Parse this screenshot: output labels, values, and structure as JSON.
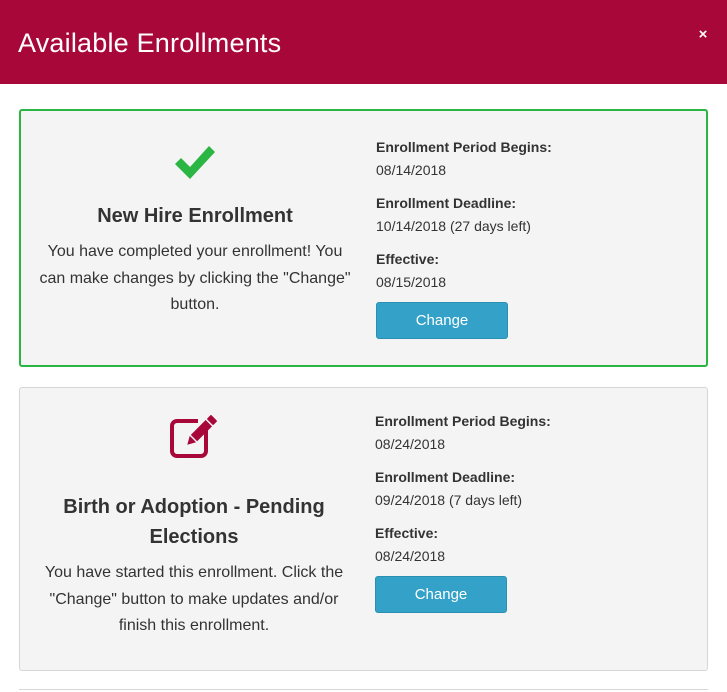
{
  "modal": {
    "title": "Available Enrollments",
    "close_label": "×"
  },
  "colors": {
    "header": "#a8073a",
    "success": "#2bb542",
    "pending_icon": "#a8073a",
    "button": "#34a2c8"
  },
  "enrollments": [
    {
      "icon": "checkmark-icon",
      "title": "New Hire Enrollment",
      "description": "You have completed your enrollment! You can make changes by clicking the \"Change\" button.",
      "period_begins_label": "Enrollment Period Begins:",
      "period_begins": "08/14/2018",
      "deadline_label": "Enrollment Deadline:",
      "deadline": "10/14/2018 (27 days left)",
      "effective_label": "Effective:",
      "effective": "08/15/2018",
      "button_label": "Change"
    },
    {
      "icon": "edit-icon",
      "title": "Birth or Adoption - Pending Elections",
      "description": "You have started this enrollment. Click the \"Change\" button to make updates and/or finish this enrollment.",
      "period_begins_label": "Enrollment Period Begins:",
      "period_begins": "08/24/2018",
      "deadline_label": "Enrollment Deadline:",
      "deadline": "09/24/2018 (7 days left)",
      "effective_label": "Effective:",
      "effective": "08/24/2018",
      "button_label": "Change"
    }
  ]
}
